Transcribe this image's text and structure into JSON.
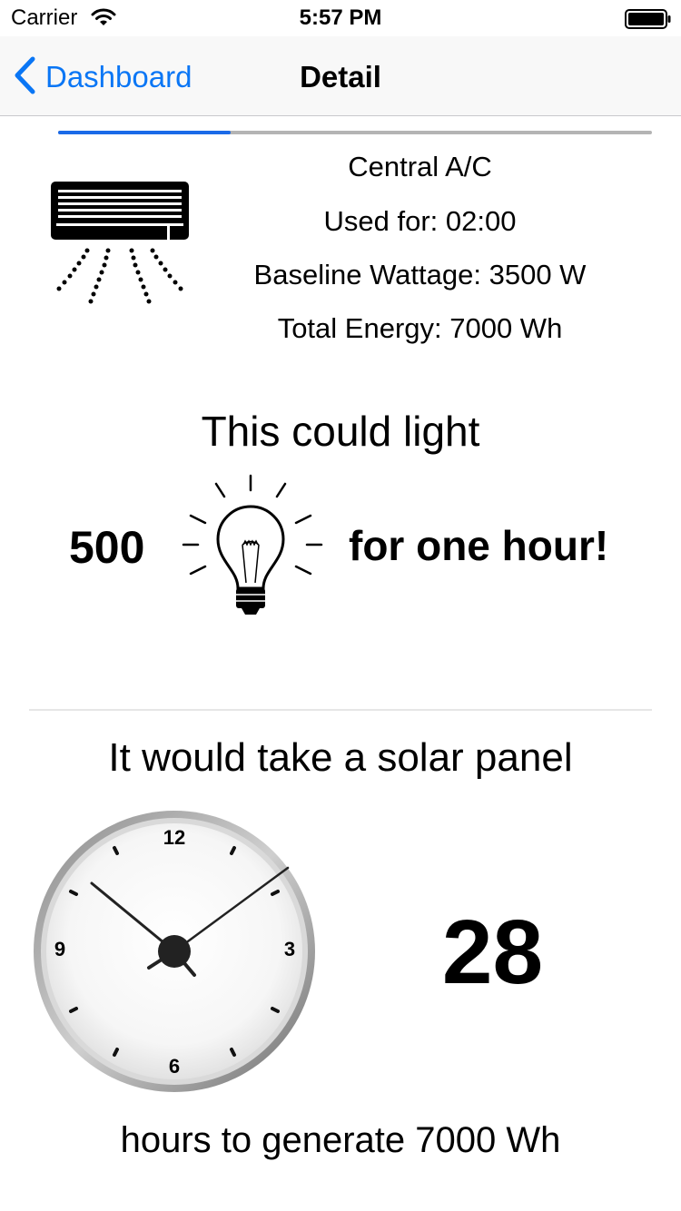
{
  "status_bar": {
    "carrier": "Carrier",
    "time": "5:57 PM",
    "wifi_icon": "wifi-icon",
    "battery_icon": "battery-icon"
  },
  "nav": {
    "back_label": "Dashboard",
    "title": "Detail",
    "back_icon": "chevron-left-icon",
    "accent": "#0a76f5"
  },
  "progress": {
    "fraction": 0.29,
    "fill_color": "#1a6ae8"
  },
  "appliance": {
    "icon": "air-conditioner-icon",
    "name": "Central A/C",
    "used_for": "Used for: 02:00",
    "baseline_wattage": "Baseline Wattage: 3500 W",
    "total_energy": "Total Energy: 7000 Wh"
  },
  "light": {
    "heading": "This could light",
    "count": "500",
    "icon": "lightbulb-icon",
    "suffix": "for one hour!"
  },
  "solar": {
    "heading": "It would take a solar panel",
    "clock_icon": "clock-icon",
    "clock_numbers": [
      "12",
      "3",
      "6",
      "9"
    ],
    "hours": "28",
    "footer": "hours to generate 7000 Wh"
  }
}
